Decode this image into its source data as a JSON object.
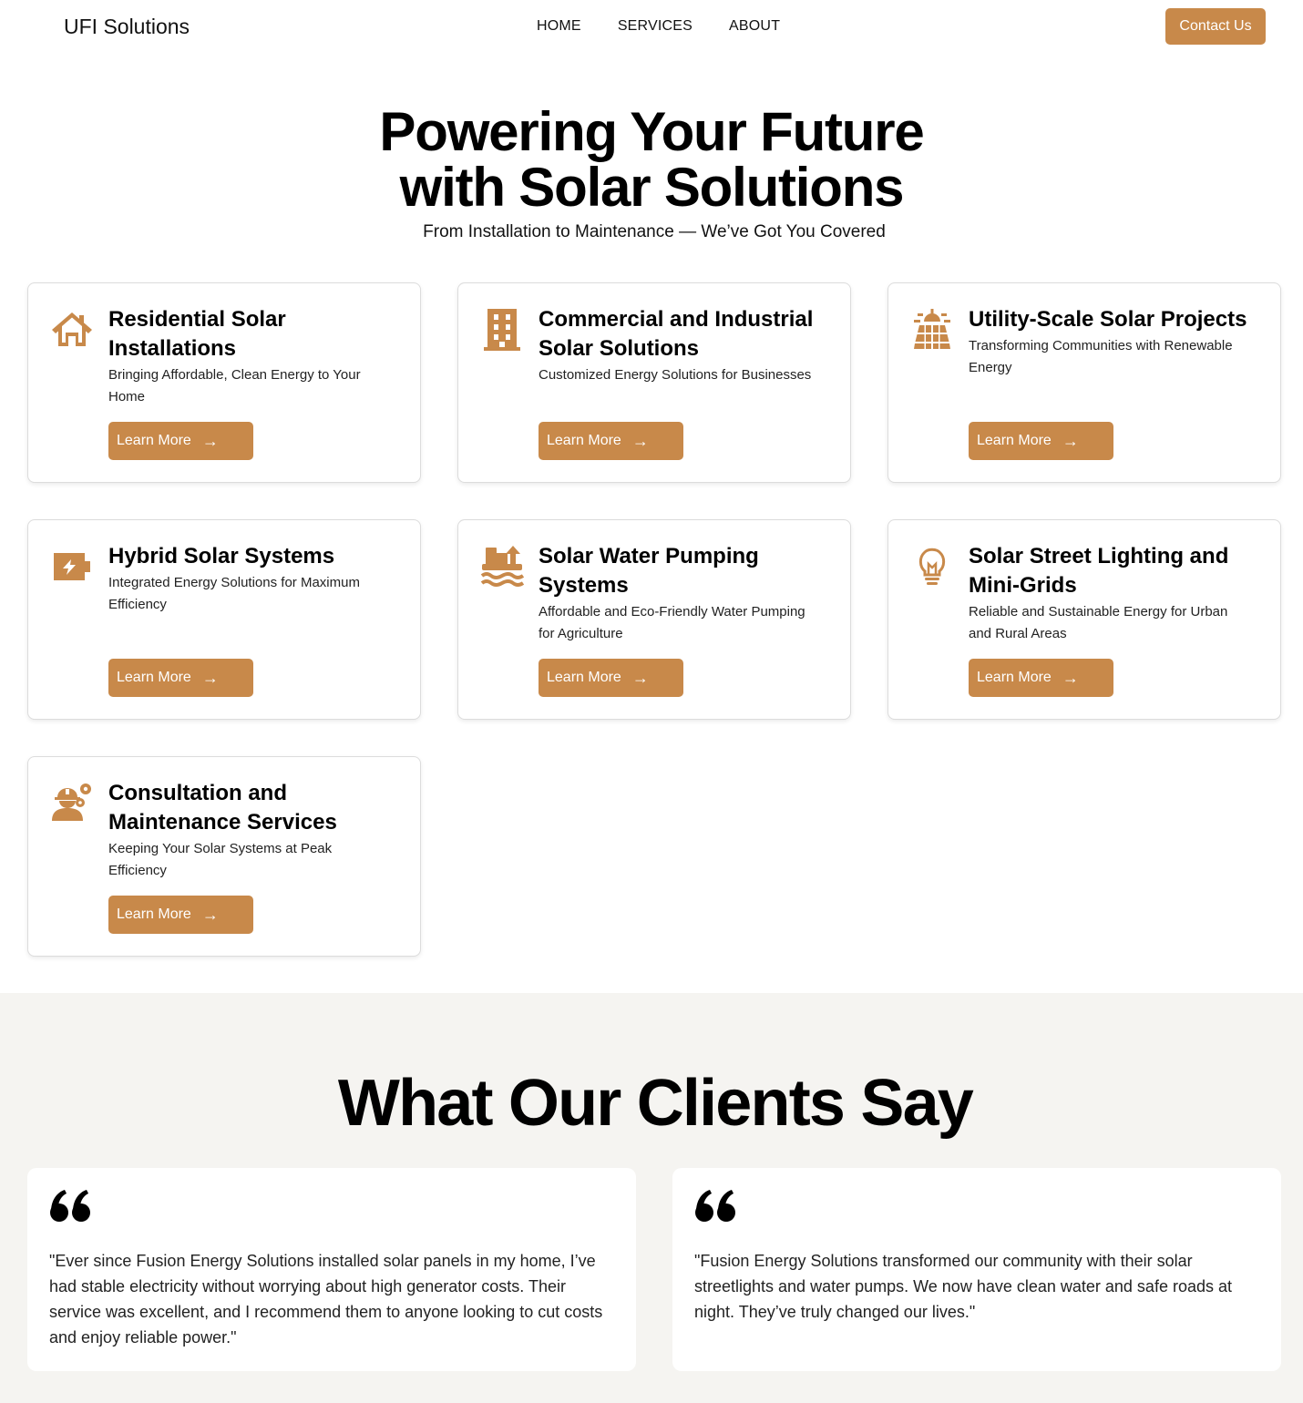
{
  "header": {
    "logo": "UFI Solutions",
    "nav": [
      "HOME",
      "SERVICES",
      "ABOUT"
    ],
    "contact_label": "Contact Us"
  },
  "hero": {
    "title_line1": "Powering Your Future",
    "title_line2": "with Solar Solutions",
    "subtitle": "From Installation to Maintenance — We’ve Got You Covered"
  },
  "services": [
    {
      "icon": "house-icon",
      "title": "Residential Solar Installations",
      "desc": "Bringing Affordable, Clean Energy to Your Home",
      "button": "Learn More"
    },
    {
      "icon": "building-icon",
      "title": "Commercial and Industrial Solar Solutions",
      "desc": "Customized Energy Solutions for Businesses",
      "button": "Learn More"
    },
    {
      "icon": "solar-panel-icon",
      "title": "Utility-Scale Solar Projects",
      "desc": "Transforming Communities with Renewable Energy",
      "button": "Learn More"
    },
    {
      "icon": "battery-bolt-icon",
      "title": "Hybrid Solar Systems",
      "desc": "Integrated Energy Solutions for Maximum Efficiency",
      "button": "Learn More"
    },
    {
      "icon": "water-pump-icon",
      "title": "Solar Water Pumping Systems",
      "desc": "Affordable and Eco-Friendly Water Pumping for Agriculture",
      "button": "Learn More"
    },
    {
      "icon": "lightbulb-icon",
      "title": "Solar Street Lighting and Mini-Grids",
      "desc": "Reliable and Sustainable Energy for Urban and Rural Areas",
      "button": "Learn More"
    },
    {
      "icon": "worker-gears-icon",
      "title": "Consultation and Maintenance Services",
      "desc": "Keeping Your Solar Systems at Peak Efficiency",
      "button": "Learn More"
    }
  ],
  "testimonials": {
    "title": "What Our Clients Say",
    "items": [
      {
        "text": "\"Ever since Fusion Energy Solutions installed solar panels in my home, I’ve had stable electricity without worrying about high generator costs. Their service was excellent, and I recommend them to anyone looking to cut costs and enjoy reliable power.\""
      },
      {
        "text": "\"Fusion Energy Solutions transformed our community with their solar streetlights and water pumps. We now have clean water and safe roads at night. They’ve truly changed our lives.\""
      }
    ]
  },
  "colors": {
    "accent": "#c8894a",
    "section_bg": "#f5f4f1"
  }
}
